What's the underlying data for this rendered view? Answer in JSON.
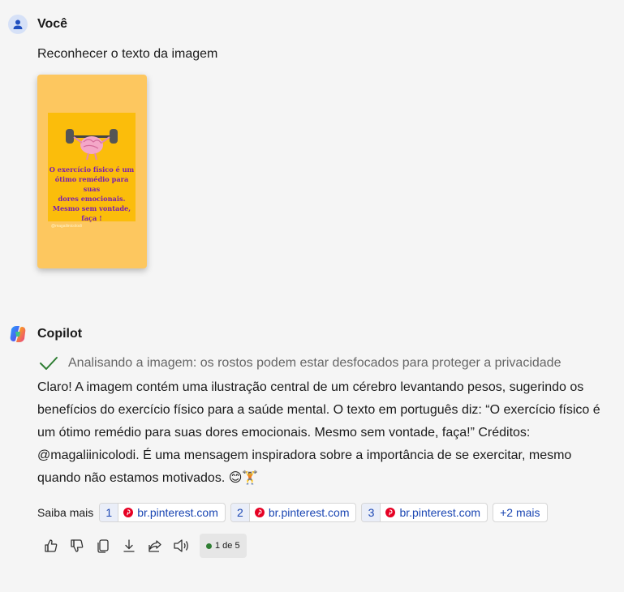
{
  "user": {
    "name": "Você",
    "message": "Reconhecer o texto da imagem",
    "image": {
      "text_lines": [
        "O exercício físico é um",
        "ótimo remédio para suas",
        "dores emocionais.",
        "Mesmo sem vontade,",
        "faça !"
      ],
      "credit": "@magaliinicolodi"
    }
  },
  "assistant": {
    "name": "Copilot",
    "status": "Analisando a imagem: os rostos podem estar desfocados para proteger a privacidade",
    "answer": "Claro! A imagem contém uma ilustração central de um cérebro levantando pesos, sugerindo os benefícios do exercício físico para a saúde mental. O texto em português diz: “O exercício físico é um ótimo remédio para suas dores emocionais. Mesmo sem vontade, faça!” Créditos: @magaliinicolodi. É uma mensagem inspiradora sobre a importância de se exercitar, mesmo quando não estamos motivados. 😊🏋️",
    "sources_label": "Saiba mais",
    "sources": [
      {
        "num": "1",
        "domain": "br.pinterest.com"
      },
      {
        "num": "2",
        "domain": "br.pinterest.com"
      },
      {
        "num": "3",
        "domain": "br.pinterest.com"
      }
    ],
    "more_sources": "+2 mais",
    "page_indicator": "1 de 5"
  },
  "colors": {
    "link": "#1a46b3",
    "check": "#2e7d32",
    "pinterest": "#e60023",
    "thumb_bg": "#fdc75f",
    "thumb_text": "#7a1fb0"
  },
  "icons": [
    "user-icon",
    "copilot-logo-icon",
    "check-icon",
    "pinterest-icon",
    "thumbs-up-icon",
    "thumbs-down-icon",
    "copy-icon",
    "download-icon",
    "share-icon",
    "speaker-icon"
  ]
}
